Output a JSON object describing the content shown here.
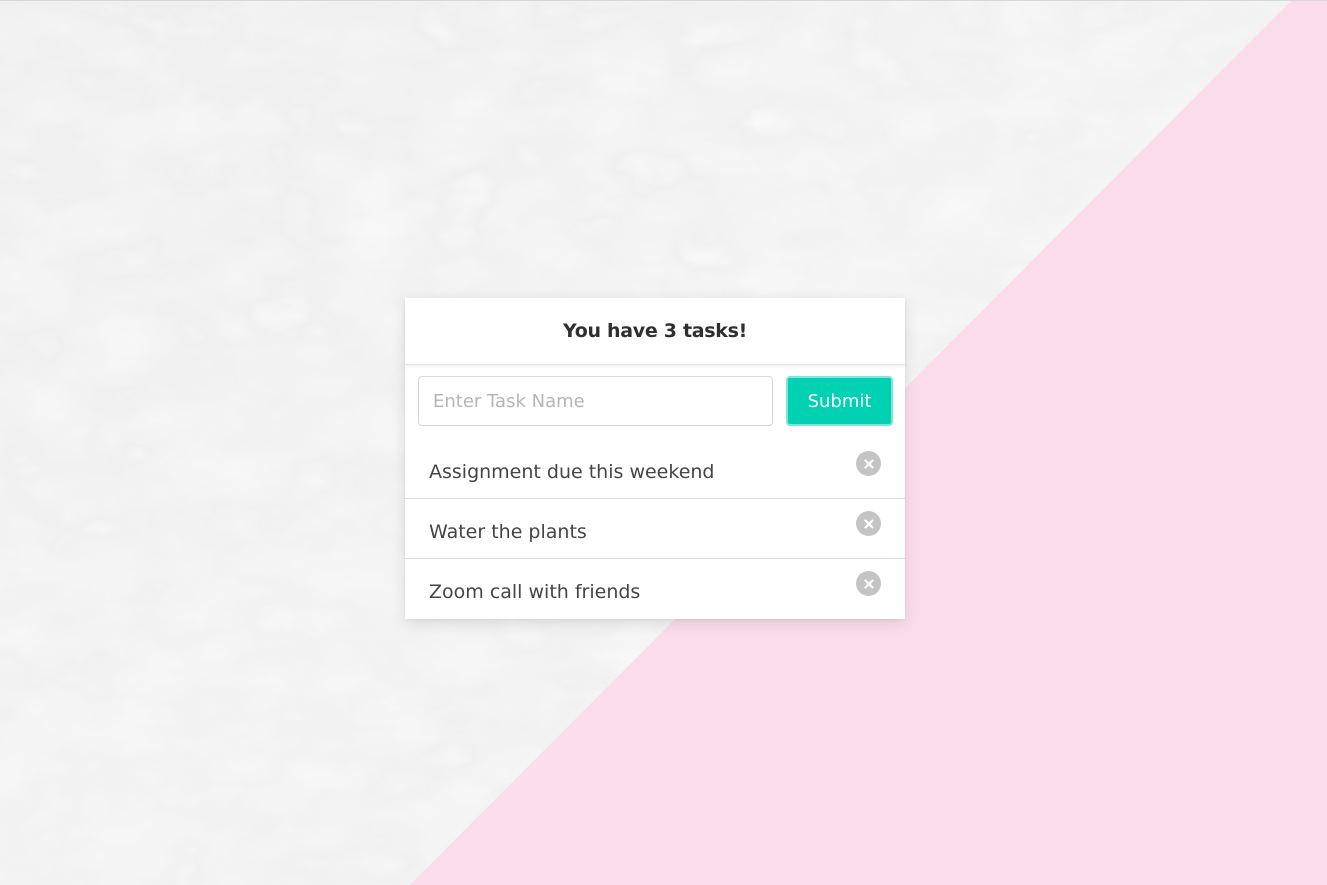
{
  "header": {
    "title": "You have 3 tasks!"
  },
  "form": {
    "input_value": "",
    "input_placeholder": "Enter Task Name",
    "submit_label": "Submit"
  },
  "tasks": [
    {
      "label": "Assignment due this weekend",
      "delete_icon": "close-circle-icon"
    },
    {
      "label": "Water the plants",
      "delete_icon": "close-circle-icon"
    },
    {
      "label": "Zoom call with friends",
      "delete_icon": "close-circle-icon"
    }
  ],
  "colors": {
    "accent": "#00d1b2",
    "background_pink": "#fbdcec",
    "marble_base": "#ececec",
    "delete_icon": "#c4c4c4"
  }
}
